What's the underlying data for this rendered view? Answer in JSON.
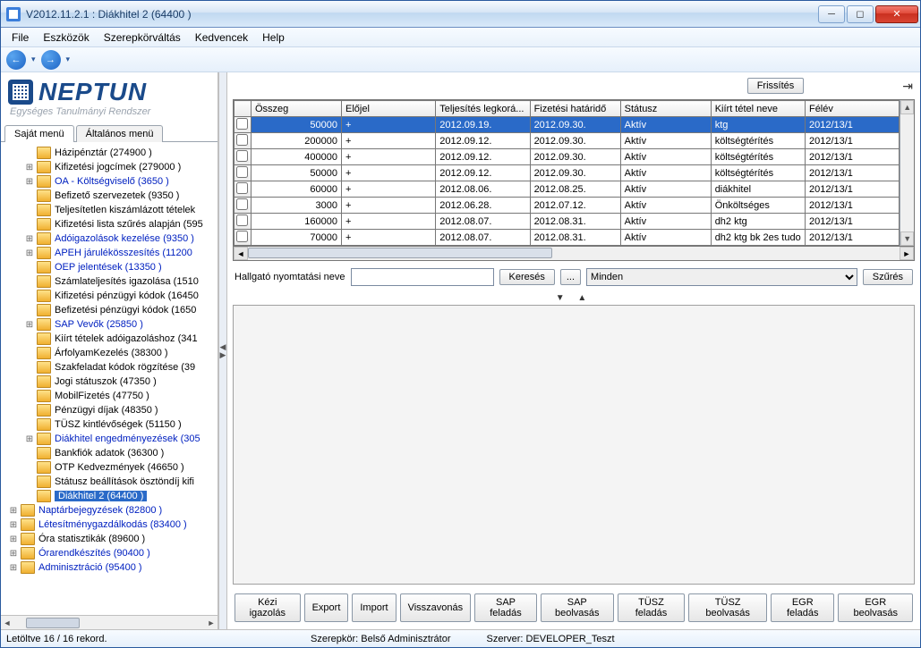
{
  "window": {
    "title": "V2012.11.2.1 : Diákhitel 2 (64400  )"
  },
  "menubar": [
    "File",
    "Eszközök",
    "Szerepkörváltás",
    "Kedvencek",
    "Help"
  ],
  "logo": {
    "name": "NEPTUN",
    "tagline": "Egységes Tanulmányi Rendszer"
  },
  "sidebar_tabs": {
    "own": "Saját menü",
    "general": "Általános menü"
  },
  "tree": [
    {
      "lvl": 1,
      "exp": "",
      "link": false,
      "label": "Házipénztár (274900  )"
    },
    {
      "lvl": 1,
      "exp": "+",
      "link": false,
      "label": "Kifizetési jogcímek (279000  )"
    },
    {
      "lvl": 1,
      "exp": "+",
      "link": true,
      "label": "OA - Költségviselő (3650  )"
    },
    {
      "lvl": 1,
      "exp": "",
      "link": false,
      "label": "Befizető szervezetek (9350  )"
    },
    {
      "lvl": 1,
      "exp": "",
      "link": false,
      "label": "Teljesítetlen kiszámlázott tételek"
    },
    {
      "lvl": 1,
      "exp": "",
      "link": false,
      "label": "Kifizetési lista szűrés alapján (595"
    },
    {
      "lvl": 1,
      "exp": "+",
      "link": true,
      "label": "Adóigazolások kezelése (9350  )"
    },
    {
      "lvl": 1,
      "exp": "+",
      "link": true,
      "label": "APEH járulékösszesítés (11200"
    },
    {
      "lvl": 1,
      "exp": "",
      "link": true,
      "label": "OEP jelentések (13350  )"
    },
    {
      "lvl": 1,
      "exp": "",
      "link": false,
      "label": "Számlateljesítés igazolása (1510"
    },
    {
      "lvl": 1,
      "exp": "",
      "link": false,
      "label": "Kifizetési pénzügyi kódok (16450"
    },
    {
      "lvl": 1,
      "exp": "",
      "link": false,
      "label": "Befizetési pénzügyi kódok (1650"
    },
    {
      "lvl": 1,
      "exp": "+",
      "link": true,
      "label": "SAP Vevők (25850  )"
    },
    {
      "lvl": 1,
      "exp": "",
      "link": false,
      "label": "Kiírt tételek adóigazoláshoz (341"
    },
    {
      "lvl": 1,
      "exp": "",
      "link": false,
      "label": "ÁrfolyamKezelés (38300  )"
    },
    {
      "lvl": 1,
      "exp": "",
      "link": false,
      "label": "Szakfeladat kódok rögzítése (39"
    },
    {
      "lvl": 1,
      "exp": "",
      "link": false,
      "label": "Jogi státuszok (47350  )"
    },
    {
      "lvl": 1,
      "exp": "",
      "link": false,
      "label": "MobilFizetés (47750  )"
    },
    {
      "lvl": 1,
      "exp": "",
      "link": false,
      "label": "Pénzügyi díjak (48350  )"
    },
    {
      "lvl": 1,
      "exp": "",
      "link": false,
      "label": "TÜSZ kintlévőségek (51150  )"
    },
    {
      "lvl": 1,
      "exp": "+",
      "link": true,
      "label": "Diákhitel engedményezések (305"
    },
    {
      "lvl": 1,
      "exp": "",
      "link": false,
      "label": "Bankfiók adatok (36300  )"
    },
    {
      "lvl": 1,
      "exp": "",
      "link": false,
      "label": "OTP Kedvezmények (46650  )"
    },
    {
      "lvl": 1,
      "exp": "",
      "link": false,
      "label": "Státusz beállítások ösztöndíj kifi"
    },
    {
      "lvl": 1,
      "exp": "",
      "link": true,
      "sel": true,
      "label": "Diákhitel 2 (64400  )"
    },
    {
      "lvl": 0,
      "exp": "+",
      "link": true,
      "label": "Naptárbejegyzések (82800  )"
    },
    {
      "lvl": 0,
      "exp": "+",
      "link": true,
      "label": "Létesítménygazdálkodás (83400  )"
    },
    {
      "lvl": 0,
      "exp": "+",
      "link": false,
      "label": "Óra statisztikák (89600  )"
    },
    {
      "lvl": 0,
      "exp": "+",
      "link": true,
      "label": "Órarendkészítés (90400  )"
    },
    {
      "lvl": 0,
      "exp": "+",
      "link": true,
      "label": "Adminisztráció (95400  )"
    }
  ],
  "toolbar": {
    "refresh": "Frissítés"
  },
  "grid": {
    "columns": [
      "Összeg",
      "Előjel",
      "Teljesítés legkorá...",
      "Fizetési határidő",
      "Státusz",
      "Kiírt tétel neve",
      "Félév"
    ],
    "rows": [
      {
        "sel": true,
        "osszeg": "50000",
        "elojel": "+",
        "telj": "2012.09.19.",
        "hat": "2012.09.30.",
        "stat": "Aktív",
        "nev": "ktg",
        "felev": "2012/13/1"
      },
      {
        "osszeg": "200000",
        "elojel": "+",
        "telj": "2012.09.12.",
        "hat": "2012.09.30.",
        "stat": "Aktív",
        "nev": "költségtérítés",
        "felev": "2012/13/1"
      },
      {
        "osszeg": "400000",
        "elojel": "+",
        "telj": "2012.09.12.",
        "hat": "2012.09.30.",
        "stat": "Aktív",
        "nev": "költségtérítés",
        "felev": "2012/13/1"
      },
      {
        "osszeg": "50000",
        "elojel": "+",
        "telj": "2012.09.12.",
        "hat": "2012.09.30.",
        "stat": "Aktív",
        "nev": "költségtérítés",
        "felev": "2012/13/1"
      },
      {
        "osszeg": "60000",
        "elojel": "+",
        "telj": "2012.08.06.",
        "hat": "2012.08.25.",
        "stat": "Aktív",
        "nev": "diákhitel",
        "felev": "2012/13/1"
      },
      {
        "osszeg": "3000",
        "elojel": "+",
        "telj": "2012.06.28.",
        "hat": "2012.07.12.",
        "stat": "Aktív",
        "nev": "Önköltséges",
        "felev": "2012/13/1"
      },
      {
        "osszeg": "160000",
        "elojel": "+",
        "telj": "2012.08.07.",
        "hat": "2012.08.31.",
        "stat": "Aktív",
        "nev": "dh2 ktg",
        "felev": "2012/13/1"
      },
      {
        "osszeg": "70000",
        "elojel": "+",
        "telj": "2012.08.07.",
        "hat": "2012.08.31.",
        "stat": "Aktív",
        "nev": "dh2 ktg bk 2es tudo",
        "felev": "2012/13/1"
      }
    ]
  },
  "filter": {
    "label": "Hallgató nyomtatási neve",
    "search": "Keresés",
    "more": "...",
    "combo_value": "Minden",
    "apply": "Szűrés"
  },
  "actions": [
    "Kézi igazolás",
    "Export",
    "Import",
    "Visszavonás",
    "SAP feladás",
    "SAP beolvasás",
    "TÜSZ feladás",
    "TÜSZ beolvasás",
    "EGR feladás",
    "EGR beolvasás"
  ],
  "statusbar": {
    "records": "Letöltve 16 / 16 rekord.",
    "role": "Szerepkör: Belső Adminisztrátor",
    "server": "Szerver: DEVELOPER_Teszt"
  }
}
